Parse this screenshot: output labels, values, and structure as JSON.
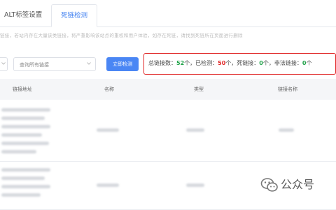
{
  "tabs": [
    {
      "label": "ALT标签设置"
    },
    {
      "label": "死链检测"
    }
  ],
  "description": "链接，若站内存在大量该类链接，将严重影响该站点的重权和用户体验，如存在死链，请找到死链所在页面进行删除",
  "filter": {
    "select_value": "查询所有链接"
  },
  "actions": {
    "check_label": "立即检测"
  },
  "stats": {
    "total_label": "总链接数：",
    "total_value": "52",
    "checked_label": "个，已检测：",
    "checked_value": "50",
    "dead_label": "个，死链接：",
    "dead_value": "0",
    "illegal_label": "个，非法链接：",
    "illegal_value": "0",
    "unit": "个"
  },
  "table": {
    "columns": [
      "链接地址",
      "名称",
      "类型",
      "链接名称"
    ]
  },
  "watermark": {
    "text": "公众号"
  },
  "colors": {
    "accent": "#3a7cf0",
    "button": "#4a86f4",
    "highlight_border": "#e02424",
    "success": "#22a34a",
    "danger": "#e02424"
  }
}
